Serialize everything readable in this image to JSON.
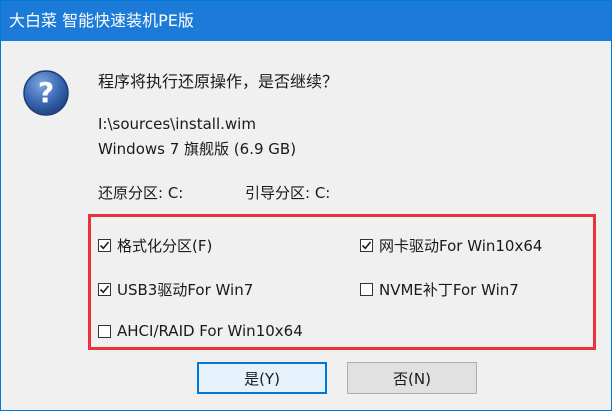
{
  "window": {
    "title": "大白菜 智能快速装机PE版"
  },
  "dialog": {
    "question": "程序将执行还原操作，是否继续？",
    "image_path": "I:\\sources\\install.wim",
    "edition": "Windows 7 旗舰版 (6.9 GB)",
    "restore_partition": "还原分区: C:",
    "boot_partition": "引导分区: C:",
    "icon": "question-icon"
  },
  "options": {
    "format": {
      "label": "格式化分区(F)",
      "checked": true
    },
    "nic_driver": {
      "label": "网卡驱动For Win10x64",
      "checked": true
    },
    "usb3_driver": {
      "label": "USB3驱动For Win7",
      "checked": true
    },
    "nvme_patch": {
      "label": "NVME补丁For Win7",
      "checked": false
    },
    "ahci_raid": {
      "label": "AHCI/RAID For Win10x64",
      "checked": false
    }
  },
  "buttons": {
    "yes": "是(Y)",
    "no": "否(N)"
  },
  "colors": {
    "titlebar": "#1c7bd8",
    "highlight_border": "#e8323c",
    "icon_blue": "#2e5fa8"
  }
}
